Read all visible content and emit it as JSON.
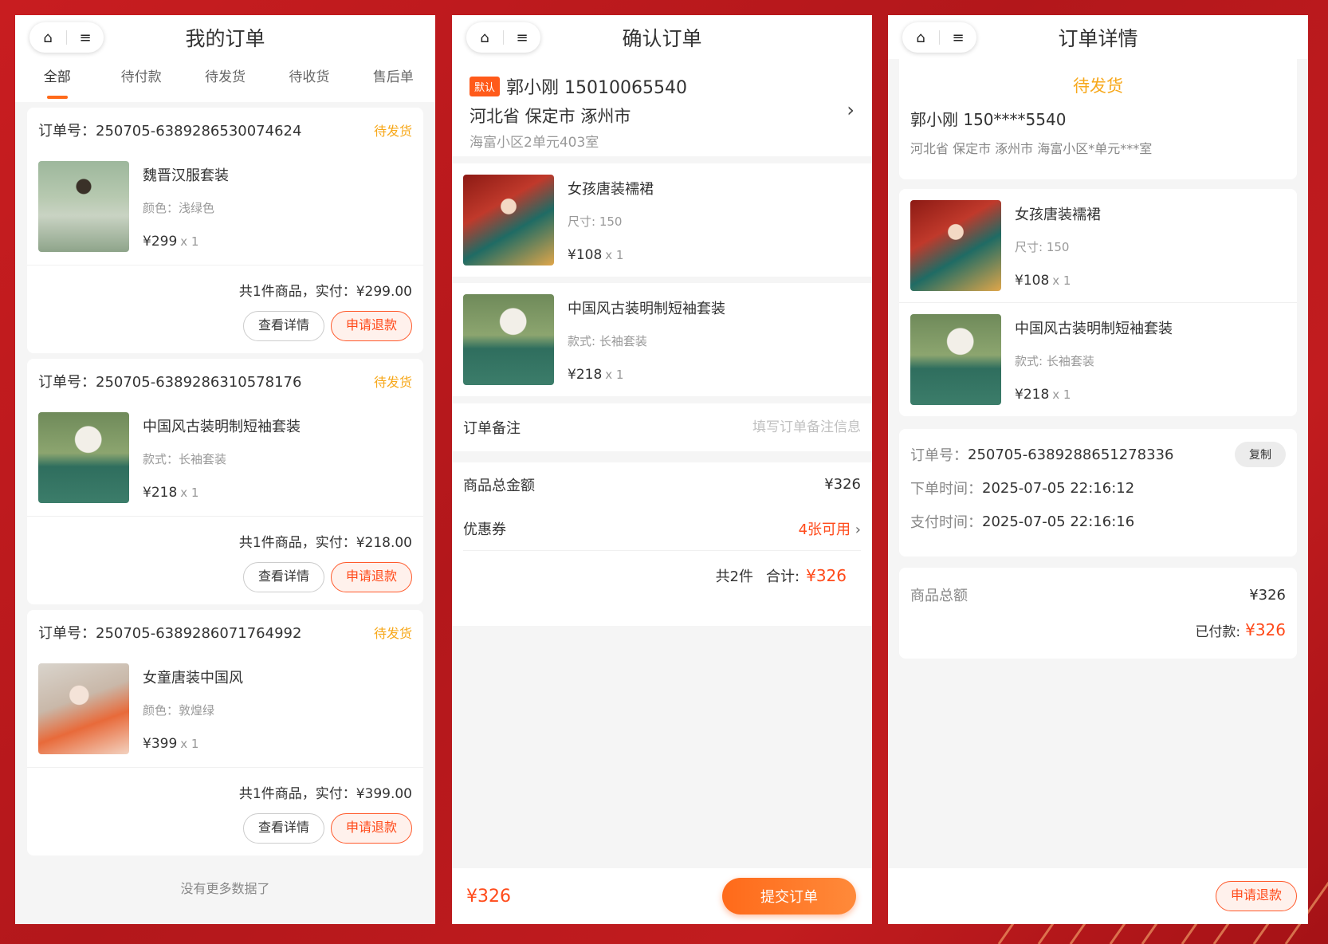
{
  "list_page": {
    "title": "我的订单",
    "capsule": {
      "home_icon": "⌂",
      "menu_icon": "≡"
    },
    "tabs": [
      "全部",
      "待付款",
      "待发货",
      "待收货",
      "售后单"
    ],
    "orders": [
      {
        "order_no": "订单号：250705-6389286530074624",
        "status": "待发货",
        "goods_name": "魏晋汉服套装",
        "spec": "颜色：浅绿色",
        "price": "¥299",
        "qty": "x 1",
        "summary": "共1件商品，实付：¥299.00",
        "btn_detail": "查看详情",
        "btn_refund": "申请退款"
      },
      {
        "order_no": "订单号：250705-6389286310578176",
        "status": "待发货",
        "goods_name": "中国风古装明制短袖套装",
        "spec": "款式：长袖套装",
        "price": "¥218",
        "qty": "x 1",
        "summary": "共1件商品，实付：¥218.00",
        "btn_detail": "查看详情",
        "btn_refund": "申请退款"
      },
      {
        "order_no": "订单号：250705-6389286071764992",
        "status": "待发货",
        "goods_name": "女童唐装中国风",
        "spec": "颜色：敦煌绿",
        "price": "¥399",
        "qty": "x 1",
        "summary": "共1件商品，实付：¥399.00",
        "btn_detail": "查看详情",
        "btn_refund": "申请退款"
      }
    ],
    "no_more": "没有更多数据了"
  },
  "confirm_page": {
    "title": "确认订单",
    "address": {
      "badge": "默认",
      "name_phone": "郭小刚 15010065540",
      "region": "河北省 保定市 涿州市",
      "detail": "海富小区2单元403室"
    },
    "goods": [
      {
        "name": "女孩唐装襦裙",
        "spec": "尺寸: 150",
        "price": "¥108",
        "qty": "x 1"
      },
      {
        "name": "中国风古装明制短袖套装",
        "spec": "款式: 长袖套装",
        "price": "¥218",
        "qty": "x 1"
      }
    ],
    "note_label": "订单备注",
    "note_placeholder": "填写订单备注信息",
    "total_label": "商品总金额",
    "total_value": "¥326",
    "coupon_label": "优惠券",
    "coupon_value": "4张可用",
    "count_text": "共2件",
    "sum_label": "合计:",
    "sum_value": "¥326",
    "bottom_price": "¥326",
    "submit": "提交订单"
  },
  "detail_page": {
    "title": "订单详情",
    "status": "待发货",
    "name_phone": "郭小刚  150****5540",
    "address": "河北省 保定市 涿州市 海富小区*单元***室",
    "goods": [
      {
        "name": "女孩唐装襦裙",
        "spec": "尺寸: 150",
        "price": "¥108",
        "qty": "x 1"
      },
      {
        "name": "中国风古装明制短袖套装",
        "spec": "款式: 长袖套装",
        "price": "¥218",
        "qty": "x 1"
      }
    ],
    "order_no_label": "订单号：",
    "order_no": "250705-6389288651278336",
    "copy": "复制",
    "order_time_label": "下单时间：",
    "order_time": "2025-07-05 22:16:12",
    "pay_time_label": "支付时间：",
    "pay_time": "2025-07-05 22:16:16",
    "total_label": "商品总额",
    "total_value": "¥326",
    "paid_label": "已付款:",
    "paid_value": "¥326",
    "refund": "申请退款"
  },
  "colors": {
    "accent": "#ff6a1a",
    "price_red": "#ff4a1a",
    "status_yellow": "#f7a81b",
    "background_red": "#c01a1d"
  }
}
